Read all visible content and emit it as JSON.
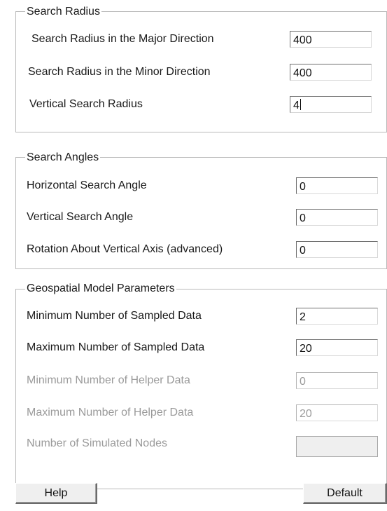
{
  "search_radius": {
    "title": "Search Radius",
    "rows": [
      {
        "label": "Search Radius in the Major Direction",
        "value": "400"
      },
      {
        "label": "Search Radius in the Minor Direction",
        "value": "400"
      },
      {
        "label": "Vertical Search Radius",
        "value": "4"
      }
    ]
  },
  "search_angles": {
    "title": "Search Angles",
    "rows": [
      {
        "label": "Horizontal Search Angle",
        "value": "0"
      },
      {
        "label": "Vertical Search Angle",
        "value": "0"
      },
      {
        "label": "Rotation About Vertical Axis (advanced)",
        "value": "0"
      }
    ]
  },
  "geospatial": {
    "title": "Geospatial Model Parameters",
    "rows": [
      {
        "label": "Minimum Number of Sampled Data",
        "value": "2",
        "enabled": true
      },
      {
        "label": "Maximum Number of Sampled Data",
        "value": "20",
        "enabled": true
      },
      {
        "label": "Minimum Number of Helper Data",
        "value": "0",
        "enabled": false
      },
      {
        "label": "Maximum Number of Helper Data",
        "value": "20",
        "enabled": false
      },
      {
        "label": "Number of Simulated Nodes",
        "value": "",
        "enabled": false
      }
    ]
  },
  "buttons": {
    "help": "Help",
    "default": "Default"
  },
  "colors": {
    "group_border": "#b9b9b9",
    "disabled_text": "#9a9a9a",
    "button_face": "#efefef"
  }
}
